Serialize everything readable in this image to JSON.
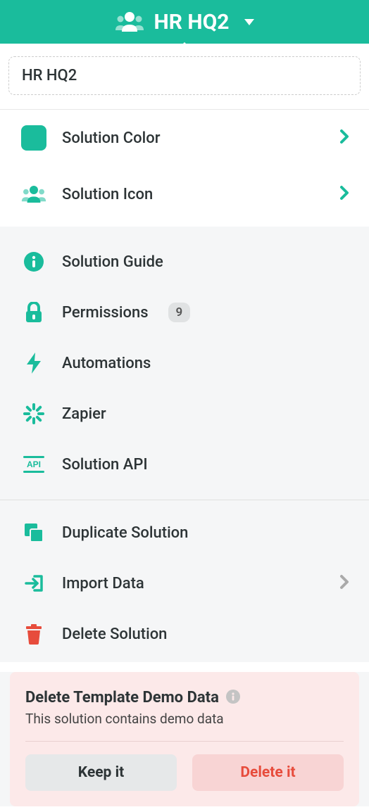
{
  "header": {
    "title": "HR HQ2"
  },
  "name_input": {
    "value": "HR HQ2"
  },
  "appearance": {
    "color_label": "Solution Color",
    "icon_label": "Solution Icon",
    "color_value": "#1abc9c"
  },
  "settings": {
    "guide_label": "Solution Guide",
    "permissions_label": "Permissions",
    "permissions_count": "9",
    "automations_label": "Automations",
    "zapier_label": "Zapier",
    "api_label": "Solution API"
  },
  "actions": {
    "duplicate_label": "Duplicate Solution",
    "import_label": "Import Data",
    "delete_label": "Delete Solution"
  },
  "demo": {
    "title": "Delete Template Demo Data",
    "subtitle": "This solution contains demo data",
    "keep_label": "Keep it",
    "delete_label": "Delete it"
  }
}
